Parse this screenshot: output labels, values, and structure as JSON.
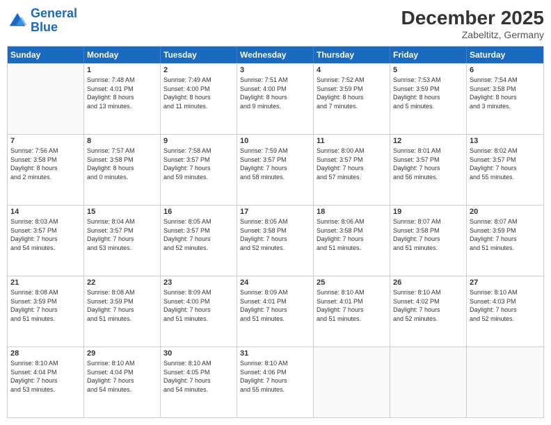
{
  "logo": {
    "line1": "General",
    "line2": "Blue"
  },
  "title": "December 2025",
  "subtitle": "Zabeltitz, Germany",
  "header_days": [
    "Sunday",
    "Monday",
    "Tuesday",
    "Wednesday",
    "Thursday",
    "Friday",
    "Saturday"
  ],
  "weeks": [
    [
      {
        "day": "",
        "info": ""
      },
      {
        "day": "1",
        "info": "Sunrise: 7:48 AM\nSunset: 4:01 PM\nDaylight: 8 hours\nand 13 minutes."
      },
      {
        "day": "2",
        "info": "Sunrise: 7:49 AM\nSunset: 4:00 PM\nDaylight: 8 hours\nand 11 minutes."
      },
      {
        "day": "3",
        "info": "Sunrise: 7:51 AM\nSunset: 4:00 PM\nDaylight: 8 hours\nand 9 minutes."
      },
      {
        "day": "4",
        "info": "Sunrise: 7:52 AM\nSunset: 3:59 PM\nDaylight: 8 hours\nand 7 minutes."
      },
      {
        "day": "5",
        "info": "Sunrise: 7:53 AM\nSunset: 3:59 PM\nDaylight: 8 hours\nand 5 minutes."
      },
      {
        "day": "6",
        "info": "Sunrise: 7:54 AM\nSunset: 3:58 PM\nDaylight: 8 hours\nand 3 minutes."
      }
    ],
    [
      {
        "day": "7",
        "info": "Sunrise: 7:56 AM\nSunset: 3:58 PM\nDaylight: 8 hours\nand 2 minutes."
      },
      {
        "day": "8",
        "info": "Sunrise: 7:57 AM\nSunset: 3:58 PM\nDaylight: 8 hours\nand 0 minutes."
      },
      {
        "day": "9",
        "info": "Sunrise: 7:58 AM\nSunset: 3:57 PM\nDaylight: 7 hours\nand 59 minutes."
      },
      {
        "day": "10",
        "info": "Sunrise: 7:59 AM\nSunset: 3:57 PM\nDaylight: 7 hours\nand 58 minutes."
      },
      {
        "day": "11",
        "info": "Sunrise: 8:00 AM\nSunset: 3:57 PM\nDaylight: 7 hours\nand 57 minutes."
      },
      {
        "day": "12",
        "info": "Sunrise: 8:01 AM\nSunset: 3:57 PM\nDaylight: 7 hours\nand 56 minutes."
      },
      {
        "day": "13",
        "info": "Sunrise: 8:02 AM\nSunset: 3:57 PM\nDaylight: 7 hours\nand 55 minutes."
      }
    ],
    [
      {
        "day": "14",
        "info": "Sunrise: 8:03 AM\nSunset: 3:57 PM\nDaylight: 7 hours\nand 54 minutes."
      },
      {
        "day": "15",
        "info": "Sunrise: 8:04 AM\nSunset: 3:57 PM\nDaylight: 7 hours\nand 53 minutes."
      },
      {
        "day": "16",
        "info": "Sunrise: 8:05 AM\nSunset: 3:57 PM\nDaylight: 7 hours\nand 52 minutes."
      },
      {
        "day": "17",
        "info": "Sunrise: 8:05 AM\nSunset: 3:58 PM\nDaylight: 7 hours\nand 52 minutes."
      },
      {
        "day": "18",
        "info": "Sunrise: 8:06 AM\nSunset: 3:58 PM\nDaylight: 7 hours\nand 51 minutes."
      },
      {
        "day": "19",
        "info": "Sunrise: 8:07 AM\nSunset: 3:58 PM\nDaylight: 7 hours\nand 51 minutes."
      },
      {
        "day": "20",
        "info": "Sunrise: 8:07 AM\nSunset: 3:59 PM\nDaylight: 7 hours\nand 51 minutes."
      }
    ],
    [
      {
        "day": "21",
        "info": "Sunrise: 8:08 AM\nSunset: 3:59 PM\nDaylight: 7 hours\nand 51 minutes."
      },
      {
        "day": "22",
        "info": "Sunrise: 8:08 AM\nSunset: 3:59 PM\nDaylight: 7 hours\nand 51 minutes."
      },
      {
        "day": "23",
        "info": "Sunrise: 8:09 AM\nSunset: 4:00 PM\nDaylight: 7 hours\nand 51 minutes."
      },
      {
        "day": "24",
        "info": "Sunrise: 8:09 AM\nSunset: 4:01 PM\nDaylight: 7 hours\nand 51 minutes."
      },
      {
        "day": "25",
        "info": "Sunrise: 8:10 AM\nSunset: 4:01 PM\nDaylight: 7 hours\nand 51 minutes."
      },
      {
        "day": "26",
        "info": "Sunrise: 8:10 AM\nSunset: 4:02 PM\nDaylight: 7 hours\nand 52 minutes."
      },
      {
        "day": "27",
        "info": "Sunrise: 8:10 AM\nSunset: 4:03 PM\nDaylight: 7 hours\nand 52 minutes."
      }
    ],
    [
      {
        "day": "28",
        "info": "Sunrise: 8:10 AM\nSunset: 4:04 PM\nDaylight: 7 hours\nand 53 minutes."
      },
      {
        "day": "29",
        "info": "Sunrise: 8:10 AM\nSunset: 4:04 PM\nDaylight: 7 hours\nand 54 minutes."
      },
      {
        "day": "30",
        "info": "Sunrise: 8:10 AM\nSunset: 4:05 PM\nDaylight: 7 hours\nand 54 minutes."
      },
      {
        "day": "31",
        "info": "Sunrise: 8:10 AM\nSunset: 4:06 PM\nDaylight: 7 hours\nand 55 minutes."
      },
      {
        "day": "",
        "info": ""
      },
      {
        "day": "",
        "info": ""
      },
      {
        "day": "",
        "info": ""
      }
    ]
  ]
}
